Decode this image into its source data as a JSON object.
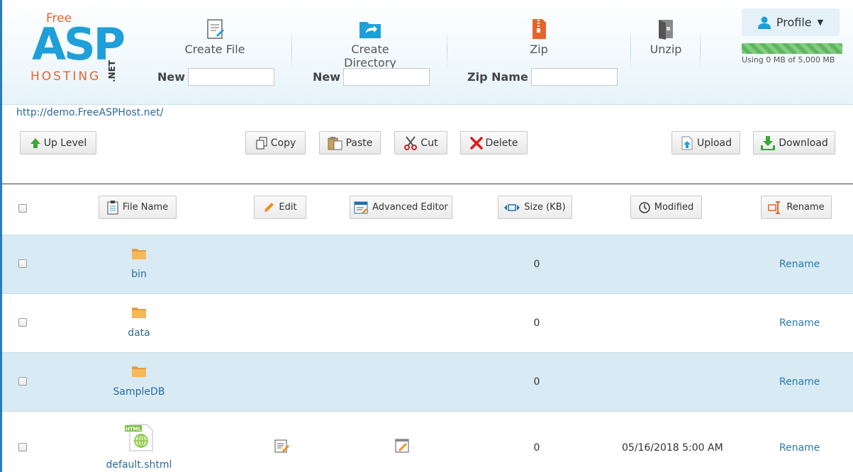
{
  "logo": {
    "free": "Free",
    "asp": "ASP",
    "hosting": "HOSTING",
    "net": ".NET"
  },
  "toolbar": {
    "create_file": "Create File",
    "create_directory": "Create Directory",
    "zip": "Zip",
    "unzip": "Unzip",
    "new_label_1": "New",
    "new_label_2": "New",
    "zip_name_label": "Zip Name",
    "new_file_value": "",
    "new_dir_value": "",
    "zip_name_value": ""
  },
  "profile": {
    "label": "Profile"
  },
  "quota": {
    "text": "Using 0 MB of 5,000 MB",
    "fraction": 1.0
  },
  "path": {
    "url": "http://demo.FreeASPHost.net/"
  },
  "actions": {
    "up_level": "Up Level",
    "copy": "Copy",
    "paste": "Paste",
    "cut": "Cut",
    "delete": "Delete",
    "upload": "Upload",
    "download": "Download"
  },
  "columns": {
    "file_name": "File Name",
    "edit": "Edit",
    "advanced_editor": "Advanced Editor",
    "size": "Size (KB)",
    "modified": "Modified",
    "rename": "Rename"
  },
  "files": [
    {
      "name": "bin",
      "size": "0",
      "modified": "",
      "rename": "Rename"
    },
    {
      "name": "data",
      "size": "0",
      "modified": "",
      "rename": "Rename"
    },
    {
      "name": "SampleDB",
      "size": "0",
      "modified": "",
      "rename": "Rename"
    },
    {
      "name": "default.shtml",
      "size": "0",
      "modified": "05/16/2018 5:00 AM",
      "rename": "Rename"
    }
  ],
  "colors": {
    "accent": "#1f9fd9",
    "brand_orange": "#e8632b",
    "row_alt": "#d8ebf5",
    "link": "#2a7aa8"
  }
}
